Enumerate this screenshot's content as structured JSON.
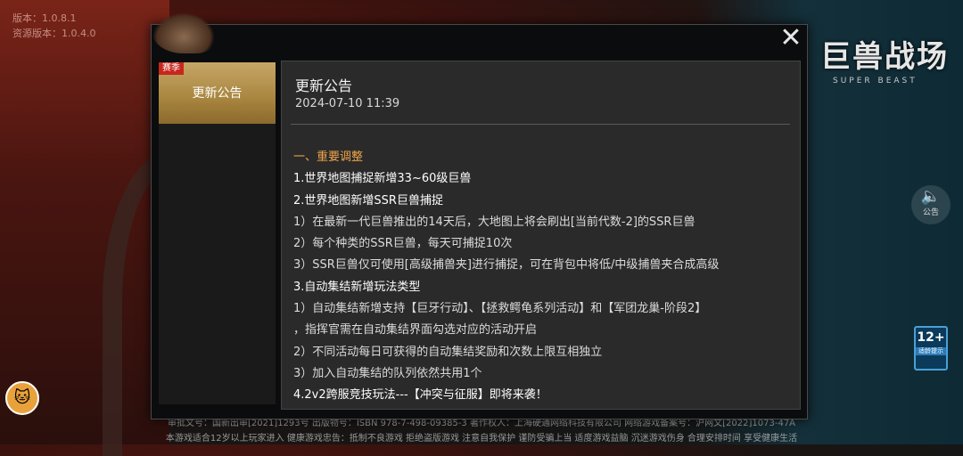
{
  "background": {
    "version_lines": [
      "版本：1.0.8.1",
      "资源版本：1.0.4.0"
    ],
    "logo": {
      "title": "巨兽战场",
      "subtitle": "SUPER BEAST"
    },
    "side_button": {
      "icon": "speaker-icon",
      "label": "公告"
    },
    "age_badge": {
      "number": "12+",
      "caption": "适龄提示"
    },
    "footer": {
      "line1": "审批文号：国新出审[2021]1293号    出版物号：ISBN 978-7-498-09385-3    著作权人：上海硬通网络科技有限公司    网络游戏备案号：沪网文[2022]1073-47A",
      "line2": "本游戏适合12岁以上玩家进入 健康游戏忠告：抵制不良游戏 拒绝盗版游戏 注意自我保护 谨防受骗上当 适度游戏益脑 沉迷游戏伤身 合理安排时间 享受健康生活"
    }
  },
  "dialog": {
    "close_icon": "close-icon",
    "tabs": [
      {
        "badge": "赛季",
        "label": "更新公告",
        "active": true
      }
    ],
    "content": {
      "title": "更新公告",
      "date": "2024-07-10 11:39",
      "lines": [
        {
          "type": "sec",
          "text": "一、重要调整"
        },
        {
          "type": "h",
          "text": "1.世界地图捕捉新增33~60级巨兽"
        },
        {
          "type": "h",
          "text": "2.世界地图新增SSR巨兽捕捉"
        },
        {
          "type": "p",
          "text": "1）在最新一代巨兽推出的14天后，大地图上将会刷出[当前代数-2]的SSR巨兽"
        },
        {
          "type": "p",
          "text": "2）每个种类的SSR巨兽，每天可捕捉10次"
        },
        {
          "type": "p",
          "text": "3）SSR巨兽仅可使用[高级捕兽夹]进行捕捉，可在背包中将低/中级捕兽夹合成高级"
        },
        {
          "type": "h",
          "text": "3.自动集结新增玩法类型"
        },
        {
          "type": "p",
          "text": "1）自动集结新增支持【巨牙行动】、【拯救鳄龟系列活动】和【军团龙巢-阶段2】"
        },
        {
          "type": "p",
          "text": "，指挥官需在自动集结界面勾选对应的活动开启"
        },
        {
          "type": "p",
          "text": "2）不同活动每日可获得的自动集结奖励和次数上限互相独立"
        },
        {
          "type": "p",
          "text": "3）加入自动集结的队列依然共用1个"
        },
        {
          "type": "h",
          "text": "4.2v2跨服竞技玩法---【冲突与征服】即将来袭！"
        }
      ]
    }
  },
  "colors": {
    "accent_gold": "#b8954e",
    "badge_red": "#c8261c",
    "section_orange": "#f0a54a"
  }
}
